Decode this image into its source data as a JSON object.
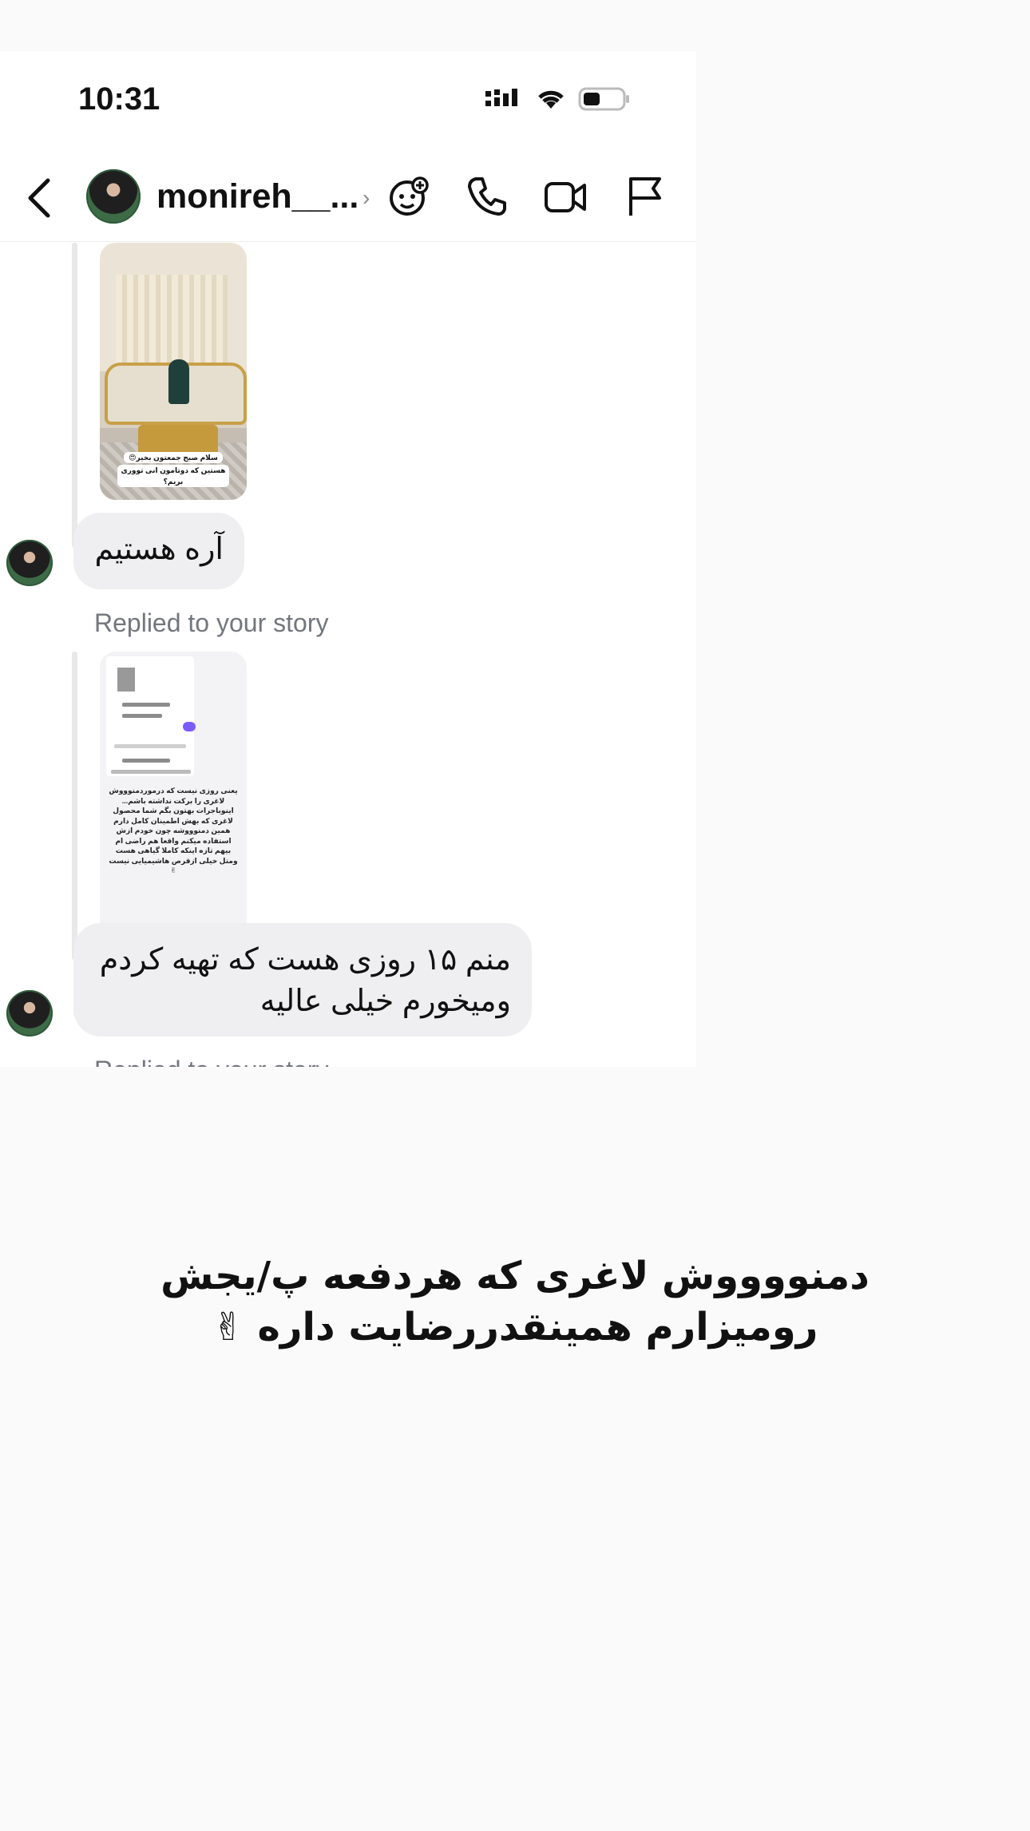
{
  "status_bar": {
    "time": "10:31",
    "icons": [
      "cellular-icon",
      "wifi-icon",
      "battery-icon"
    ]
  },
  "header": {
    "username": "monireh__...",
    "chevron": "›",
    "icons": [
      "back-icon",
      "add-effect-icon",
      "phone-icon",
      "video-icon",
      "flag-icon"
    ]
  },
  "messages": [
    {
      "type": "story_reply",
      "caption_lines": [
        "سلام صبح جمعتون بخیر😍",
        "هستین که دوتامون انی تووری بریم؟"
      ]
    },
    {
      "type": "text",
      "text": "آره هستیم"
    },
    {
      "type": "story_reply",
      "label": "Replied to your story",
      "story_text": "یعنی روزی نیست که درموردمنوووش لاغری را برکت نداشته باشم... اینوباجرات بهتون بگم شما محصول لاغری که بهش اطمینان کامل دارم همین دمنوووشه چون خودم ازش استفاده میکنم واقعا هم راضی ام بیهم تازه اینکه کاملا گیاهی هست ومتل خیلی ازقرص هاشیمیایی نیست✌"
    },
    {
      "type": "text",
      "text": "منم ۱۵ روزی هست که تهیه کردم ومیخورم خیلی عالیه"
    },
    {
      "type": "label_partial",
      "label": "Replied to your story"
    }
  ],
  "caption": {
    "line1": "دمنووووش لاغری که هردفعه پ/یجش",
    "line2": "رومیزارم همینقدررضایت داره ✌"
  },
  "colors": {
    "bubble": "#efeff1",
    "background": "#fafafa",
    "muted": "#72767d"
  }
}
